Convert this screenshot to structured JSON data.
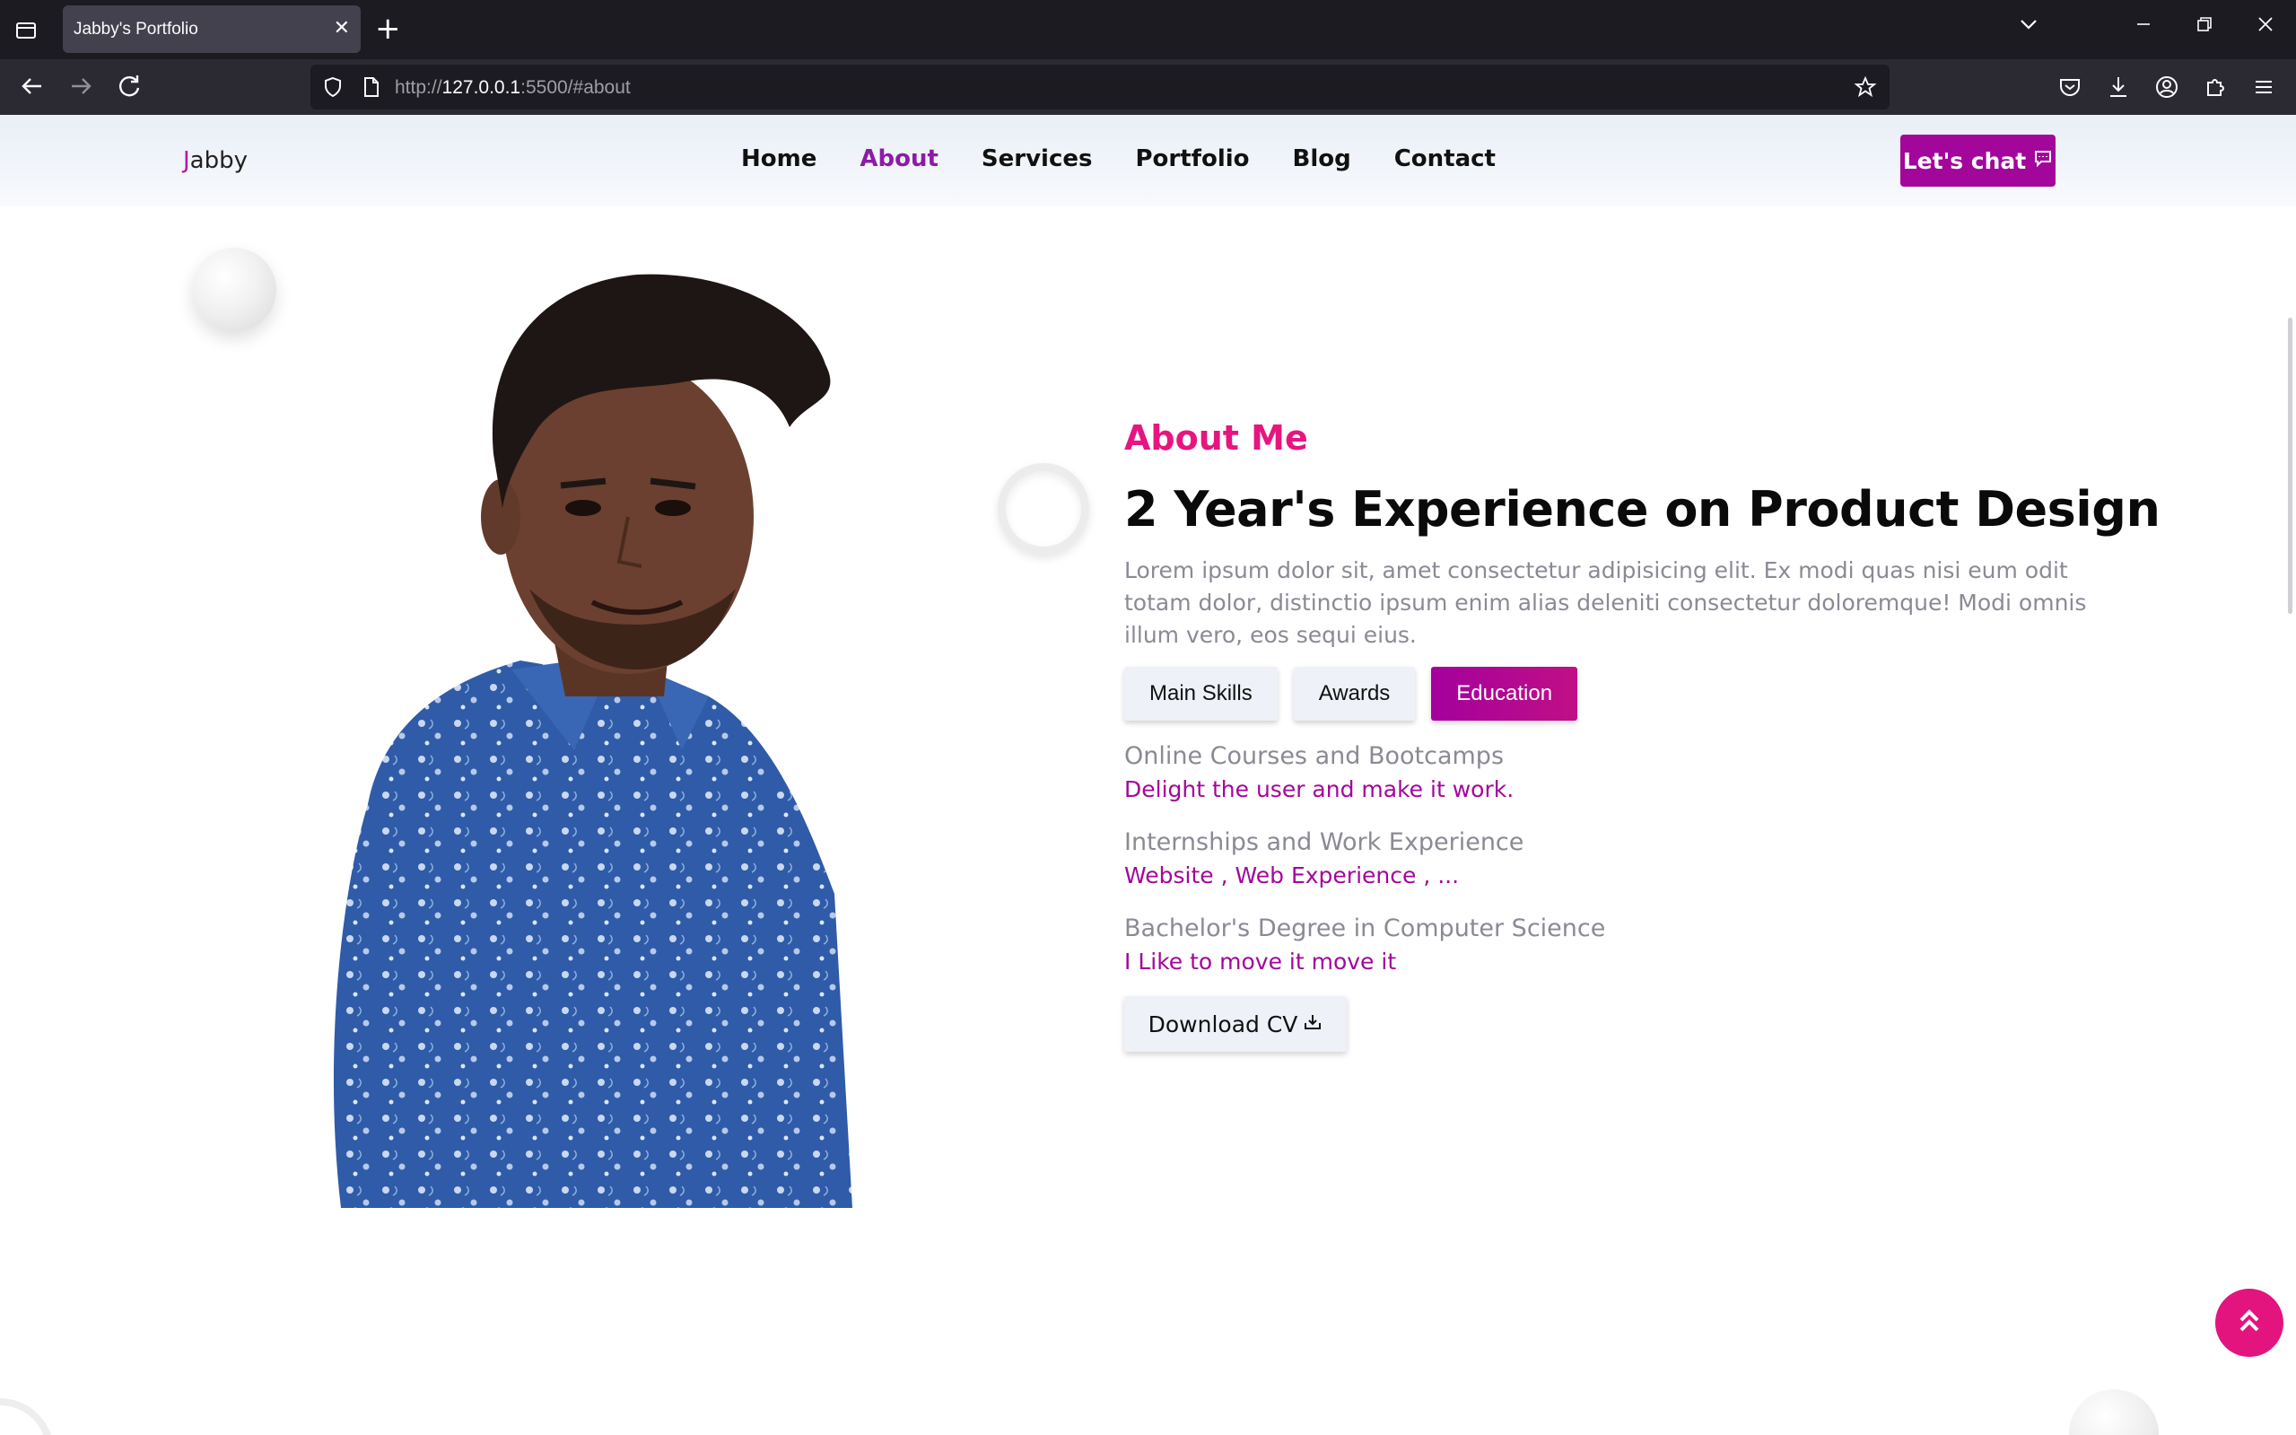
{
  "browser": {
    "tab_title": "Jabby's Portfolio",
    "url_prefix": "http://",
    "url_host": "127.0.0.1",
    "url_rest": ":5500/#about"
  },
  "site": {
    "logo_first": "J",
    "logo_rest": "abby",
    "menu": [
      "Home",
      "About",
      "Services",
      "Portfolio",
      "Blog",
      "Contact"
    ],
    "active_menu": "About",
    "chat_label": "Let's chat"
  },
  "about": {
    "subtitle": "About Me",
    "title": "2 Year's Experience on Product Design",
    "description": "Lorem ipsum dolor sit, amet consectetur adipisicing elit. Ex modi quas nisi eum odit totam dolor, distinctio ipsum enim alias deleniti consectetur doloremque! Modi omnis illum vero, eos sequi eius.",
    "tabs": [
      "Main Skills",
      "Awards",
      "Education"
    ],
    "active_tab": "Education",
    "education": [
      {
        "heading": "Online Courses and Bootcamps",
        "detail": "Delight the user and make it work."
      },
      {
        "heading": "Internships and Work Experience",
        "detail": "Website , Web Experience , ..."
      },
      {
        "heading": "Bachelor's Degree in Computer Science",
        "detail": "I Like to move it move it"
      }
    ],
    "download_label": "Download CV"
  },
  "colors": {
    "accent": "#a3069b",
    "pink": "#e6157f",
    "muted_text": "#8a8a95"
  }
}
